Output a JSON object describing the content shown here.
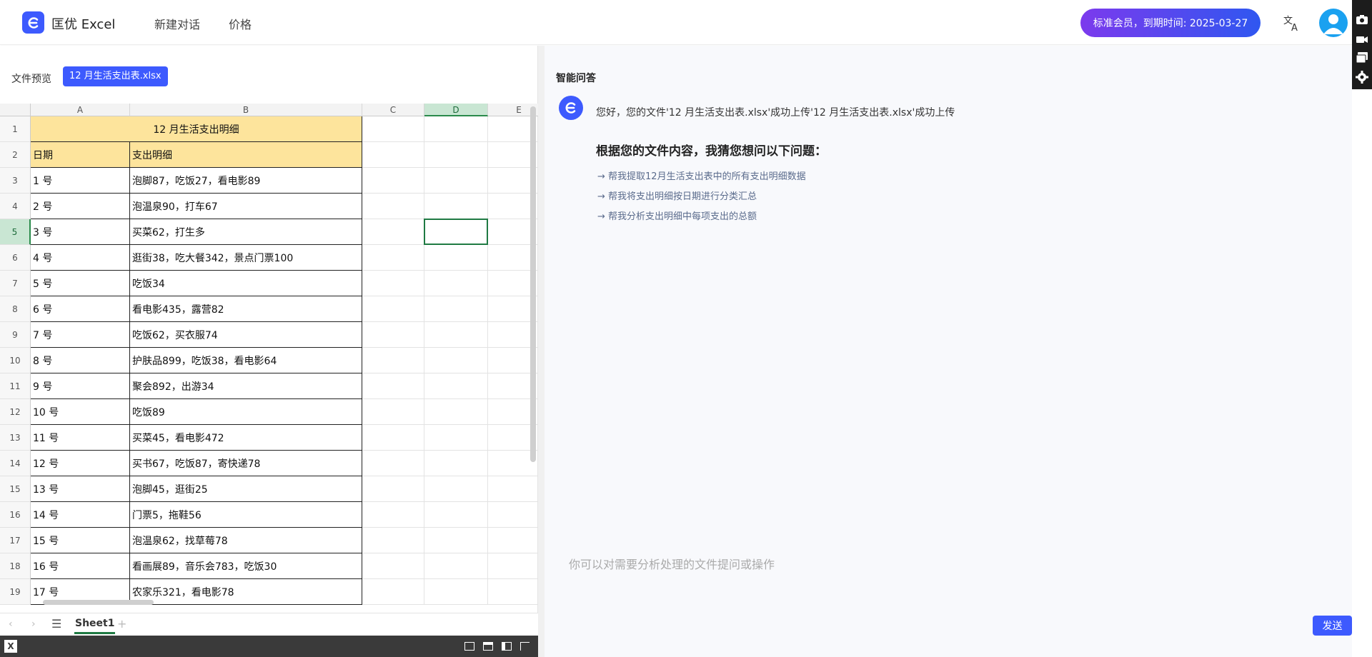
{
  "header": {
    "app_name": "匡优 Excel",
    "nav": [
      "新建对话",
      "价格"
    ],
    "membership": "标准会员，到期时间: 2025-03-27"
  },
  "left": {
    "preview_label": "文件预览",
    "file_name": "12 月生活支出表.xlsx",
    "columns": [
      "A",
      "B",
      "C",
      "D",
      "E"
    ],
    "rows": [
      {
        "n": "1",
        "a": "12 月生活支出明细",
        "b": ""
      },
      {
        "n": "2",
        "a": "日期",
        "b": "支出明细"
      },
      {
        "n": "3",
        "a": "1 号",
        "b": "泡脚87，吃饭27，看电影89"
      },
      {
        "n": "4",
        "a": "2 号",
        "b": "泡温泉90，打车67"
      },
      {
        "n": "5",
        "a": "3 号",
        "b": "买菜62，打生多"
      },
      {
        "n": "6",
        "a": "4 号",
        "b": "逛街38，吃大餐342，景点门票100"
      },
      {
        "n": "7",
        "a": "5 号",
        "b": "吃饭34"
      },
      {
        "n": "8",
        "a": "6 号",
        "b": "看电影435，露营82"
      },
      {
        "n": "9",
        "a": "7 号",
        "b": "吃饭62，买衣服74"
      },
      {
        "n": "10",
        "a": "8 号",
        "b": "护肤品899，吃饭38，看电影64"
      },
      {
        "n": "11",
        "a": "9 号",
        "b": "聚会892，出游34"
      },
      {
        "n": "12",
        "a": "10 号",
        "b": "吃饭89"
      },
      {
        "n": "13",
        "a": "11 号",
        "b": "买菜45，看电影472"
      },
      {
        "n": "14",
        "a": "12 号",
        "b": "买书67，吃饭87，寄快递78"
      },
      {
        "n": "15",
        "a": "13 号",
        "b": "泡脚45，逛街25"
      },
      {
        "n": "16",
        "a": "14 号",
        "b": "门票5，拖鞋56"
      },
      {
        "n": "17",
        "a": "15 号",
        "b": "泡温泉62，找草莓78"
      },
      {
        "n": "18",
        "a": "16 号",
        "b": "看画展89，音乐会783，吃饭30"
      },
      {
        "n": "19",
        "a": "17 号",
        "b": "农家乐321，看电影78"
      }
    ],
    "sheet_tab": "Sheet1"
  },
  "right": {
    "title": "智能问答",
    "bot_message": "您好，您的文件'12 月生活支出表.xlsx'成功上传'12 月生活支出表.xlsx'成功上传",
    "suggest_title": "根据您的文件内容，我猜您想问以下问题：",
    "suggestions": [
      "→ 帮我提取12月生活支出表中的所有支出明细数据",
      "→ 帮我将支出明细按日期进行分类汇总",
      "→ 帮我分析支出明细中每项支出的总额"
    ],
    "input_placeholder": "你可以对需要分析处理的文件提问或操作",
    "send_label": "发送"
  },
  "colors": {
    "accent": "#3d5afe",
    "excel_green": "#1f7a43",
    "header_fill": "#fde49c"
  }
}
